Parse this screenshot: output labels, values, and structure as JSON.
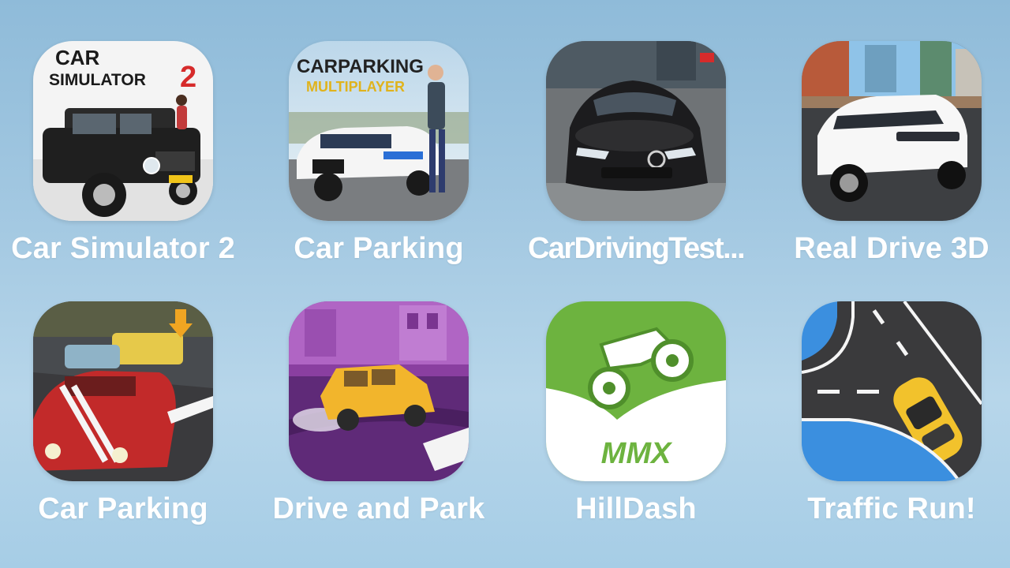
{
  "apps": [
    {
      "label": "Car Simulator 2",
      "icon": "car-simulator-2-icon",
      "title_line1": "CAR",
      "title_line2": "SIMULATOR",
      "title_num": "2"
    },
    {
      "label": "Car Parking",
      "icon": "car-parking-multiplayer-icon",
      "title_line1": "CARPARKING",
      "title_line2": "MULTIPLAYER"
    },
    {
      "label": "CarDrivingTest...",
      "icon": "car-driving-test-icon"
    },
    {
      "label": "Real Drive 3D",
      "icon": "real-drive-3d-icon"
    },
    {
      "label": "Car Parking",
      "icon": "car-parking-red-car-icon"
    },
    {
      "label": "Drive and Park",
      "icon": "drive-and-park-icon"
    },
    {
      "label": "HillDash",
      "icon": "hilldash-mmx-icon",
      "badge": "MMX"
    },
    {
      "label": "Traffic Run!",
      "icon": "traffic-run-icon"
    }
  ],
  "colors": {
    "background_top": "#8fbbd9",
    "label_text": "#ffffff",
    "hilldash_green": "#6db33f"
  }
}
